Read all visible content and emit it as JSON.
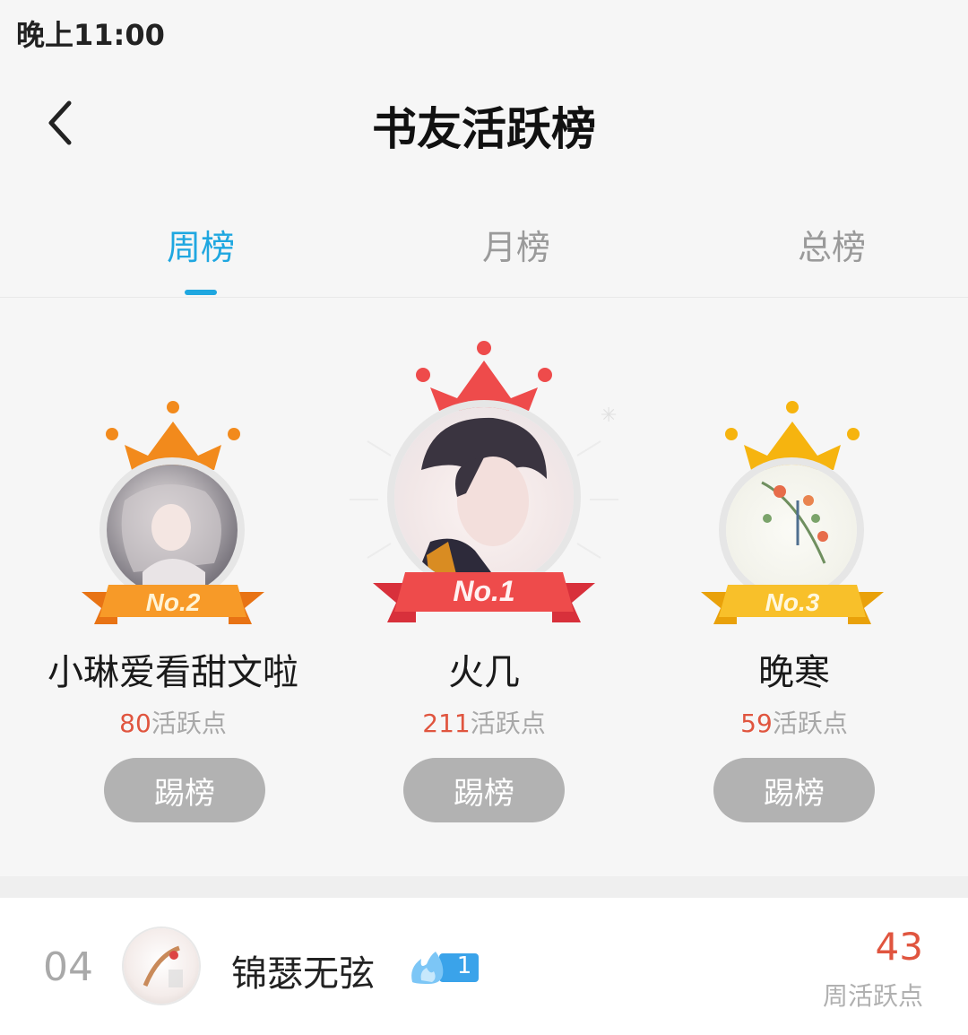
{
  "status": {
    "time": "晚上11:00"
  },
  "header": {
    "title": "书友活跃榜"
  },
  "tabs": [
    {
      "label": "周榜",
      "active": true
    },
    {
      "label": "月榜",
      "active": false
    },
    {
      "label": "总榜",
      "active": false
    }
  ],
  "podium": [
    {
      "rank_label": "No.2",
      "name": "小琳爱看甜文啦",
      "points": "80",
      "points_unit": "活跃点",
      "button": "踢榜",
      "color": "#f28a1c"
    },
    {
      "rank_label": "No.1",
      "name": "火几",
      "points": "211",
      "points_unit": "活跃点",
      "button": "踢榜",
      "color": "#ee4b4b"
    },
    {
      "rank_label": "No.3",
      "name": "晚寒",
      "points": "59",
      "points_unit": "活跃点",
      "button": "踢榜",
      "color": "#f6b40f"
    }
  ],
  "list": [
    {
      "rank": "04",
      "name": "锦瑟无弦",
      "badge_level": "1",
      "score": "43",
      "score_label": "周活跃点"
    }
  ],
  "colors": {
    "accent": "#1fa7e0",
    "points": "#e0553f",
    "button_gray": "#b2b2b2"
  }
}
